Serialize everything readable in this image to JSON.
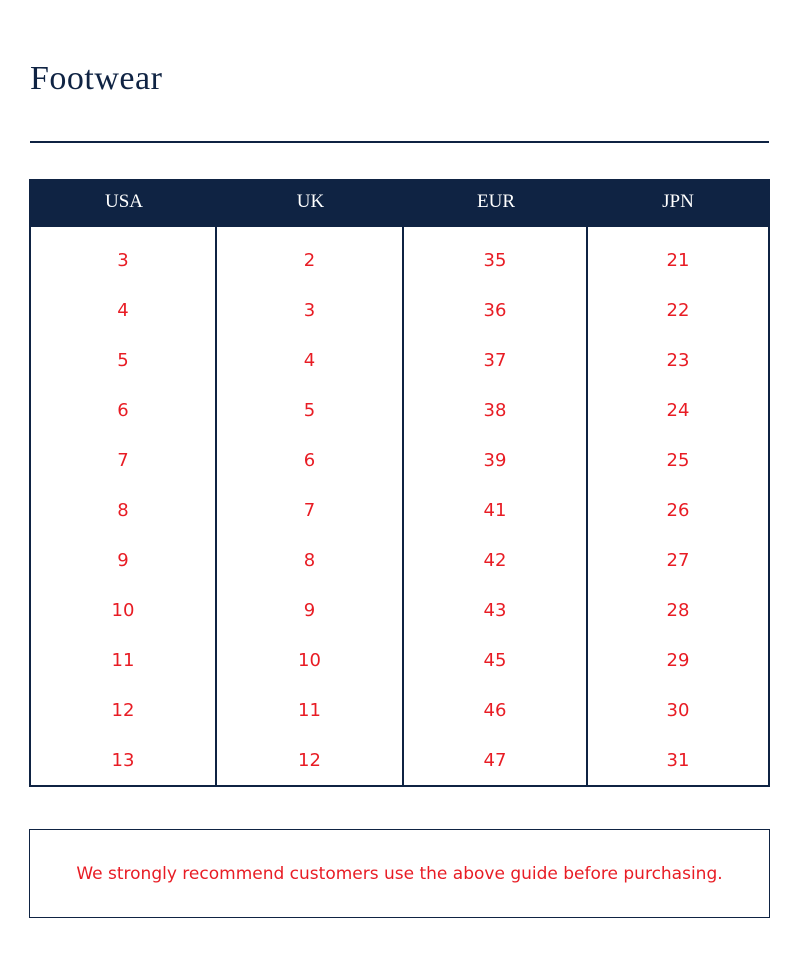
{
  "page": {
    "title": "Footwear",
    "note": "We strongly recommend customers use the above guide before purchasing."
  },
  "table": {
    "headers": [
      "USA",
      "UK",
      "EUR",
      "JPN"
    ],
    "columns": [
      [
        "3",
        "4",
        "5",
        "6",
        "7",
        "8",
        "9",
        "10",
        "11",
        "12",
        "13"
      ],
      [
        "2",
        "3",
        "4",
        "5",
        "6",
        "7",
        "8",
        "9",
        "10",
        "11",
        "12"
      ],
      [
        "35",
        "36",
        "37",
        "38",
        "39",
        "41",
        "42",
        "43",
        "45",
        "46",
        "47"
      ],
      [
        "21",
        "22",
        "23",
        "24",
        "25",
        "26",
        "27",
        "28",
        "29",
        "30",
        "31"
      ]
    ]
  },
  "colors": {
    "navy": "#0f2343",
    "red": "#e81c24"
  }
}
